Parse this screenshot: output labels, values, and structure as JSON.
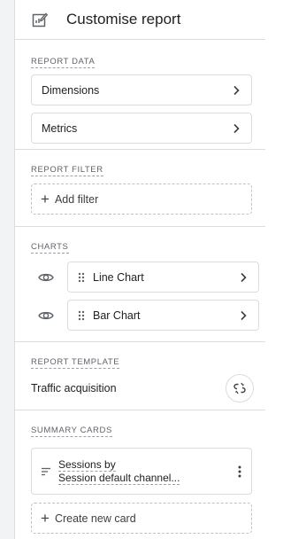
{
  "header": {
    "title": "Customise report",
    "icon": "edit-report-icon"
  },
  "report_data": {
    "label": "REPORT DATA",
    "items": [
      {
        "label": "Dimensions"
      },
      {
        "label": "Metrics"
      }
    ]
  },
  "report_filter": {
    "label": "REPORT FILTER",
    "add_label": "Add filter"
  },
  "charts": {
    "label": "CHARTS",
    "items": [
      {
        "label": "Line Chart"
      },
      {
        "label": "Bar Chart"
      }
    ]
  },
  "report_template": {
    "label": "REPORT TEMPLATE",
    "name": "Traffic acquisition"
  },
  "summary_cards": {
    "label": "SUMMARY CARDS",
    "card_line1": "Sessions by",
    "card_line2": "Session default channel...",
    "create_label": "Create new card"
  },
  "colors": {
    "border": "#dadce0",
    "text": "#202124",
    "muted": "#5f6368",
    "rail": "#f1f3f4"
  }
}
